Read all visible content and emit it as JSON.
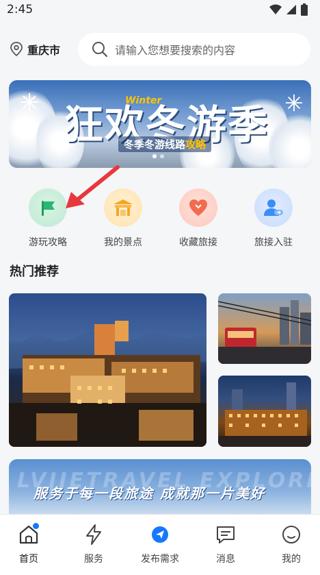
{
  "status_bar": {
    "time": "2:45"
  },
  "location": {
    "city": "重庆市"
  },
  "search": {
    "placeholder": "请输入您想要搜索的内容"
  },
  "banner": {
    "title": "狂欢冬游季",
    "title_en": "Winter",
    "subtitle_prefix": "冬季冬游线路",
    "subtitle_highlight": "攻略"
  },
  "quick_actions": [
    {
      "label": "游玩攻略",
      "icon": "flag-icon",
      "color": "#2bb673"
    },
    {
      "label": "我的景点",
      "icon": "scenic-gate-icon",
      "color": "#f5a623"
    },
    {
      "label": "收藏旅接",
      "icon": "heart-icon",
      "color": "#f26b4f"
    },
    {
      "label": "旅接入驻",
      "icon": "user-register-icon",
      "color": "#3a8ef6"
    }
  ],
  "section": {
    "title": "热门推荐"
  },
  "promo": {
    "bg_text": "LVJIETRAVEL EXPLORE",
    "slogan": "服务于每一段旅途 成就那一片美好"
  },
  "tabbar": [
    {
      "label": "首页",
      "icon": "home-icon",
      "active": true
    },
    {
      "label": "服务",
      "icon": "lightning-icon",
      "active": false
    },
    {
      "label": "发布需求",
      "icon": "publish-icon",
      "active": false
    },
    {
      "label": "消息",
      "icon": "message-icon",
      "active": false
    },
    {
      "label": "我的",
      "icon": "profile-icon",
      "active": false
    }
  ],
  "colors": {
    "accent": "#1677ff",
    "annotation_arrow": "#e8383d"
  }
}
